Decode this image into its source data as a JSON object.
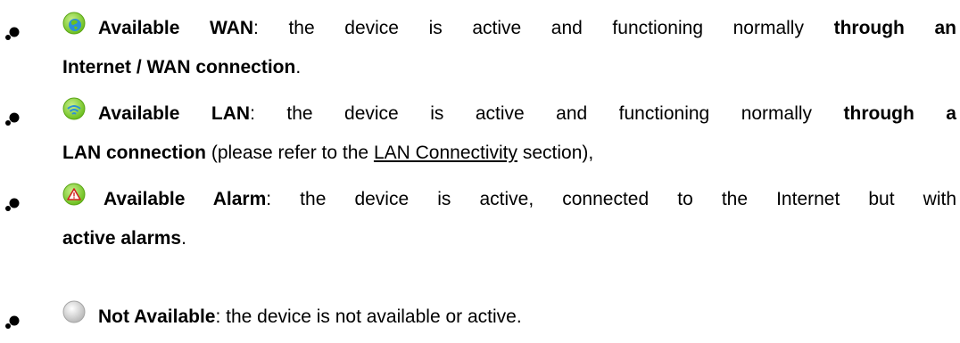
{
  "items": [
    {
      "icon": "globe-wan-icon",
      "label": "Available WAN",
      "text1": ": the device is active and functioning normally ",
      "bold1": "through an",
      "bold2": "Internet / WAN connection",
      "text2": "."
    },
    {
      "icon": "wifi-lan-icon",
      "label": "Available LAN",
      "text1": ": the device is active and functioning normally ",
      "bold1": "through a",
      "bold2": "LAN connection",
      "text2": " (please refer to the ",
      "link": "LAN Connectivity",
      "text3": " section),"
    },
    {
      "icon": "alarm-warning-icon",
      "label": "Available Alarm",
      "text1": ": the device is active, connected to the Internet but with",
      "bold2": "active alarms",
      "text2": "."
    },
    {
      "icon": "not-available-icon",
      "label": "Not Available",
      "text1": ": the device is not available or active."
    }
  ]
}
